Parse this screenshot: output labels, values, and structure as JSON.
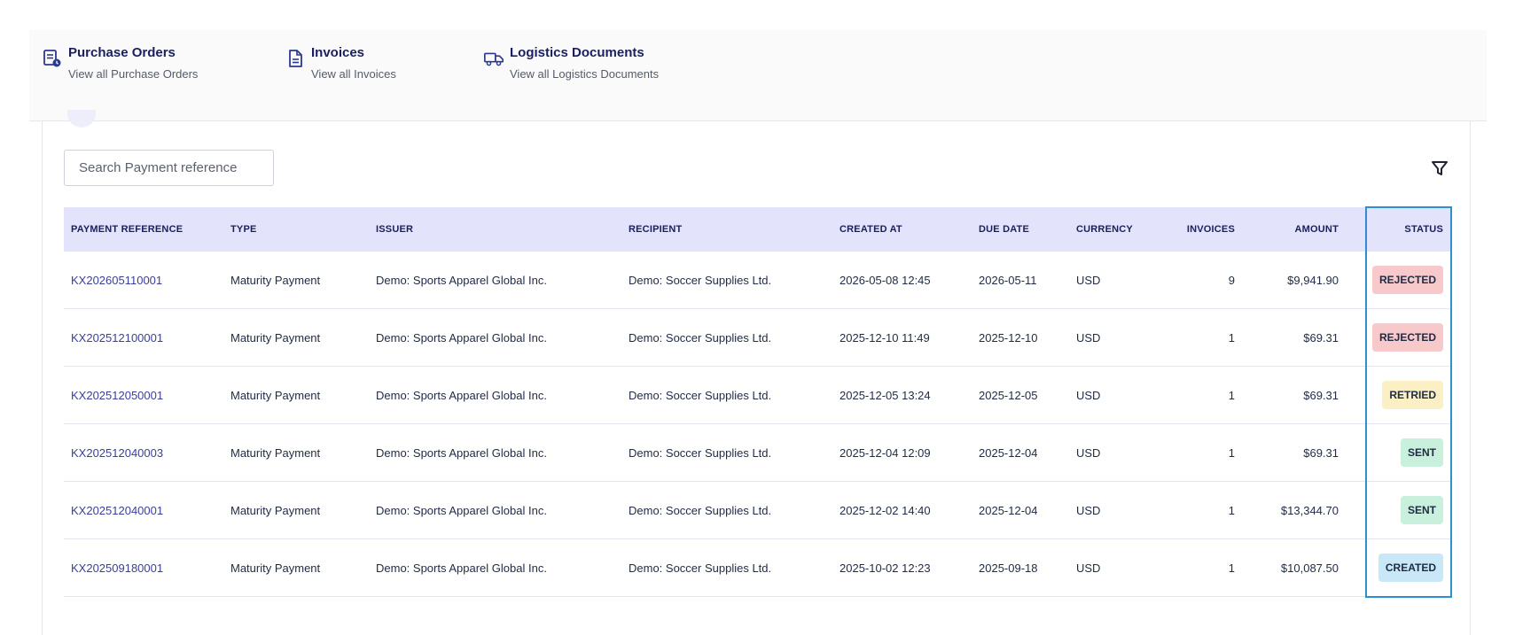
{
  "nav": {
    "items": [
      {
        "title": "Purchase Orders",
        "subtitle": "View all Purchase Orders",
        "icon": "purchase-order-icon"
      },
      {
        "title": "Invoices",
        "subtitle": "View all Invoices",
        "icon": "document-icon"
      },
      {
        "title": "Logistics Documents",
        "subtitle": "View all Logistics Documents",
        "icon": "truck-icon"
      }
    ]
  },
  "search": {
    "placeholder": "Search Payment reference",
    "value": ""
  },
  "filter": {
    "icon": "filter-icon"
  },
  "table": {
    "headers": {
      "ref": "PAYMENT REFERENCE",
      "type": "TYPE",
      "issuer": "ISSUER",
      "recipient": "RECIPIENT",
      "created": "CREATED AT",
      "due": "DUE DATE",
      "currency": "CURRENCY",
      "invoices": "INVOICES",
      "amount": "AMOUNT",
      "status": "STATUS"
    },
    "rows": [
      {
        "ref": "KX202605110001",
        "type": "Maturity Payment",
        "issuer": "Demo: Sports Apparel Global Inc.",
        "recipient": "Demo: Soccer Supplies Ltd.",
        "created": "2026-05-08 12:45",
        "due": "2026-05-11",
        "currency": "USD",
        "invoices": "9",
        "amount": "$9,941.90",
        "status": "REJECTED"
      },
      {
        "ref": "KX202512100001",
        "type": "Maturity Payment",
        "issuer": "Demo: Sports Apparel Global Inc.",
        "recipient": "Demo: Soccer Supplies Ltd.",
        "created": "2025-12-10 11:49",
        "due": "2025-12-10",
        "currency": "USD",
        "invoices": "1",
        "amount": "$69.31",
        "status": "REJECTED"
      },
      {
        "ref": "KX202512050001",
        "type": "Maturity Payment",
        "issuer": "Demo: Sports Apparel Global Inc.",
        "recipient": "Demo: Soccer Supplies Ltd.",
        "created": "2025-12-05 13:24",
        "due": "2025-12-05",
        "currency": "USD",
        "invoices": "1",
        "amount": "$69.31",
        "status": "RETRIED"
      },
      {
        "ref": "KX202512040003",
        "type": "Maturity Payment",
        "issuer": "Demo: Sports Apparel Global Inc.",
        "recipient": "Demo: Soccer Supplies Ltd.",
        "created": "2025-12-04 12:09",
        "due": "2025-12-04",
        "currency": "USD",
        "invoices": "1",
        "amount": "$69.31",
        "status": "SENT"
      },
      {
        "ref": "KX202512040001",
        "type": "Maturity Payment",
        "issuer": "Demo: Sports Apparel Global Inc.",
        "recipient": "Demo: Soccer Supplies Ltd.",
        "created": "2025-12-02 14:40",
        "due": "2025-12-04",
        "currency": "USD",
        "invoices": "1",
        "amount": "$13,344.70",
        "status": "SENT"
      },
      {
        "ref": "KX202509180001",
        "type": "Maturity Payment",
        "issuer": "Demo: Sports Apparel Global Inc.",
        "recipient": "Demo: Soccer Supplies Ltd.",
        "created": "2025-10-02 12:23",
        "due": "2025-09-18",
        "currency": "USD",
        "invoices": "1",
        "amount": "$10,087.50",
        "status": "CREATED"
      }
    ]
  },
  "status_colors": {
    "REJECTED": "#f7c9cb",
    "RETRIED": "#fbf0c4",
    "SENT": "#c8f0dc",
    "CREATED": "#c9e8f7"
  },
  "highlight_color": "#2b8fd6"
}
